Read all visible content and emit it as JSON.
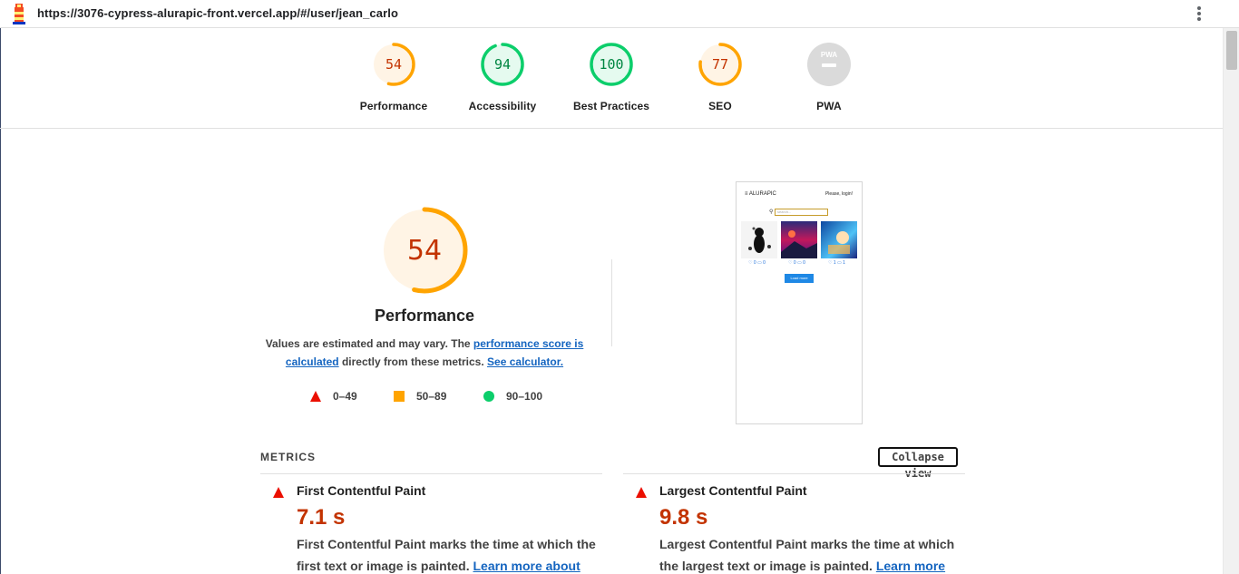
{
  "topbar": {
    "url": "https://3076-cypress-alurapic-front.vercel.app/#/user/jean_carlo",
    "logo_icon": "lighthouse-icon",
    "menu_icon": "kebab-menu-icon"
  },
  "colors": {
    "fail": "#eb0f00",
    "average": "#ffa400",
    "pass": "#0cce6b",
    "fail_text": "#c33300",
    "average_text": "#c33300",
    "pass_text": "#018642",
    "link": "#1565c0"
  },
  "score_gauges": [
    {
      "label": "Performance",
      "score": "54",
      "level": 0.54,
      "rating": "average"
    },
    {
      "label": "Accessibility",
      "score": "94",
      "level": 0.94,
      "rating": "pass"
    },
    {
      "label": "Best Practices",
      "score": "100",
      "level": 1.0,
      "rating": "pass"
    },
    {
      "label": "SEO",
      "score": "77",
      "level": 0.77,
      "rating": "average"
    },
    {
      "label": "PWA",
      "score": "",
      "level": 0,
      "rating": "pwa",
      "badge_text": "PWA"
    }
  ],
  "performance": {
    "score": "54",
    "level": 0.54,
    "title": "Performance",
    "desc_prefix": "Values are estimated and may vary. The ",
    "desc_link1": "performance score is calculated",
    "desc_middle": " directly from these metrics. ",
    "desc_link2": "See calculator.",
    "legend": [
      {
        "range": "0–49",
        "shape": "triangle",
        "color": "#eb0f00"
      },
      {
        "range": "50–89",
        "shape": "square",
        "color": "#ffa400"
      },
      {
        "range": "90–100",
        "shape": "circle",
        "color": "#0cce6b"
      }
    ]
  },
  "thumbnail": {
    "brand": "≡ ALURAPIC",
    "login": "Please, login!",
    "search_placeholder": "search...",
    "cards": [
      {
        "likes": "♡ 0",
        "comments": "▭ 0"
      },
      {
        "likes": "♡ 0",
        "comments": "▭ 0"
      },
      {
        "likes": "♡ 1",
        "comments": "▭ 1"
      }
    ],
    "load_more": "Load more"
  },
  "metrics": {
    "section_title": "METRICS",
    "collapse_label": "Collapse view",
    "items": [
      {
        "title": "First Contentful Paint",
        "value": "7.1 s",
        "desc": "First Contentful Paint marks the time at which the first text or image is painted. ",
        "link": "Learn more about the"
      },
      {
        "title": "Largest Contentful Paint",
        "value": "9.8 s",
        "desc": "Largest Contentful Paint marks the time at which the largest text or image is painted. ",
        "link": "Learn more"
      }
    ]
  }
}
